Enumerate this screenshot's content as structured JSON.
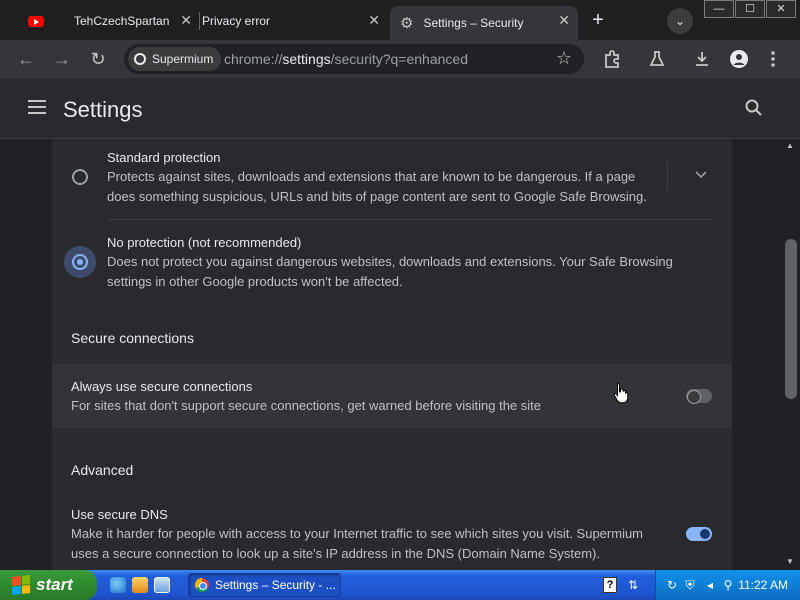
{
  "browser": {
    "tabs": [
      {
        "title": "TehCzechSpartan",
        "close": "✕"
      },
      {
        "title": "Privacy error",
        "close": "✕"
      },
      {
        "title": "Settings – Security",
        "close": "✕"
      }
    ],
    "new_tab": "+",
    "tab_search": "⌄",
    "window_controls": {
      "minimize": "—",
      "maximize": "☐",
      "close": "✕"
    }
  },
  "toolbar": {
    "back": "←",
    "forward": "→",
    "reload": "↻",
    "site_chip": "Supermium",
    "url_scheme": "chrome://",
    "url_host": "settings",
    "url_path": "/security?q=enhanced",
    "icons": [
      "extensions-icon",
      "labs-icon",
      "download-icon",
      "profile-icon",
      "menu-icon"
    ]
  },
  "header": {
    "title": "Settings",
    "search_glyph": "🔍"
  },
  "options": {
    "standard": {
      "title": "Standard protection",
      "description": "Protects against sites, downloads and extensions that are known to be dangerous. If a page does something suspicious, URLs and bits of page content are sent to Google Safe Browsing.",
      "selected": false
    },
    "none": {
      "title": "No protection (not recommended)",
      "description": "Does not protect you against dangerous websites, downloads and extensions. Your Safe Browsing settings in other Google products won't be affected.",
      "selected": true
    }
  },
  "secure_connections": {
    "heading": "Secure connections",
    "always_secure": {
      "title": "Always use secure connections",
      "description": "For sites that don't support secure connections, get warned before visiting the site",
      "enabled": false
    }
  },
  "advanced": {
    "heading": "Advanced",
    "secure_dns": {
      "title": "Use secure DNS",
      "description": "Make it harder for people with access to your Internet traffic to see which sites you visit. Supermium uses a secure connection to look up a site's IP address in the DNS (Domain Name System).",
      "enabled": true
    }
  },
  "taskbar": {
    "start_label": "start",
    "task_label": "Settings – Security - ...",
    "clock": "11:22 AM",
    "help": "?"
  },
  "colors": {
    "accent": "#8ab4f8",
    "background": "#202124",
    "card": "#292a2d"
  }
}
